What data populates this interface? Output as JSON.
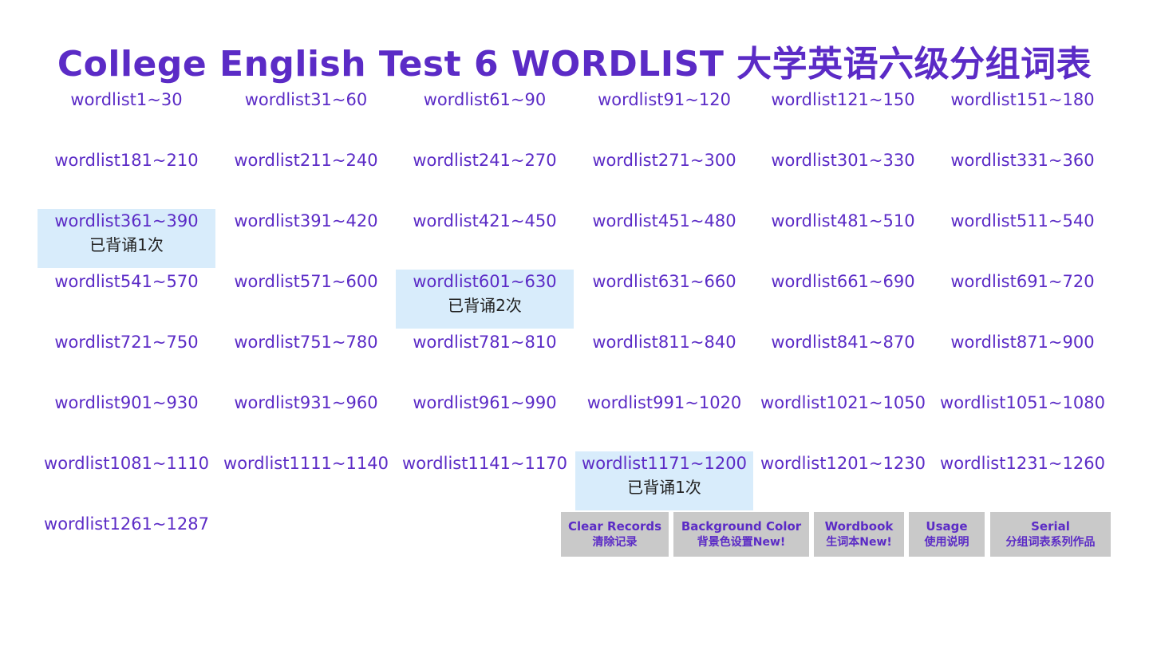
{
  "title": "College English Test 6 WORDLIST  大学英语六级分组词表",
  "wordlists": [
    {
      "label": "wordlist1~30"
    },
    {
      "label": "wordlist31~60"
    },
    {
      "label": "wordlist61~90"
    },
    {
      "label": "wordlist91~120"
    },
    {
      "label": "wordlist121~150"
    },
    {
      "label": "wordlist151~180"
    },
    {
      "label": "wordlist181~210"
    },
    {
      "label": "wordlist211~240"
    },
    {
      "label": "wordlist241~270"
    },
    {
      "label": "wordlist271~300"
    },
    {
      "label": "wordlist301~330"
    },
    {
      "label": "wordlist331~360"
    },
    {
      "label": "wordlist361~390",
      "status": "已背诵1次"
    },
    {
      "label": "wordlist391~420"
    },
    {
      "label": "wordlist421~450"
    },
    {
      "label": "wordlist451~480"
    },
    {
      "label": "wordlist481~510"
    },
    {
      "label": "wordlist511~540"
    },
    {
      "label": "wordlist541~570"
    },
    {
      "label": "wordlist571~600"
    },
    {
      "label": "wordlist601~630",
      "status": "已背诵2次"
    },
    {
      "label": "wordlist631~660"
    },
    {
      "label": "wordlist661~690"
    },
    {
      "label": "wordlist691~720"
    },
    {
      "label": "wordlist721~750"
    },
    {
      "label": "wordlist751~780"
    },
    {
      "label": "wordlist781~810"
    },
    {
      "label": "wordlist811~840"
    },
    {
      "label": "wordlist841~870"
    },
    {
      "label": "wordlist871~900"
    },
    {
      "label": "wordlist901~930"
    },
    {
      "label": "wordlist931~960"
    },
    {
      "label": "wordlist961~990"
    },
    {
      "label": "wordlist991~1020"
    },
    {
      "label": "wordlist1021~1050"
    },
    {
      "label": "wordlist1051~1080"
    },
    {
      "label": "wordlist1081~1110"
    },
    {
      "label": "wordlist1111~1140"
    },
    {
      "label": "wordlist1141~1170"
    },
    {
      "label": "wordlist1171~1200",
      "status": "已背诵1次"
    },
    {
      "label": "wordlist1201~1230"
    },
    {
      "label": "wordlist1231~1260"
    },
    {
      "label": "wordlist1261~1287"
    }
  ],
  "buttons": [
    {
      "en": "Clear Records",
      "zh": "清除记录"
    },
    {
      "en": "Background Color",
      "zh": "背景色设置New!"
    },
    {
      "en": "Wordbook",
      "zh": "生词本New!"
    },
    {
      "en": "Usage",
      "zh": "使用说明"
    },
    {
      "en": "Serial",
      "zh": "分组词表系列作品"
    }
  ],
  "colors": {
    "accent": "#5b2bc6",
    "highlight": "#d8ecfb",
    "button_bg": "#c9c9c9",
    "status_text": "#222222"
  }
}
